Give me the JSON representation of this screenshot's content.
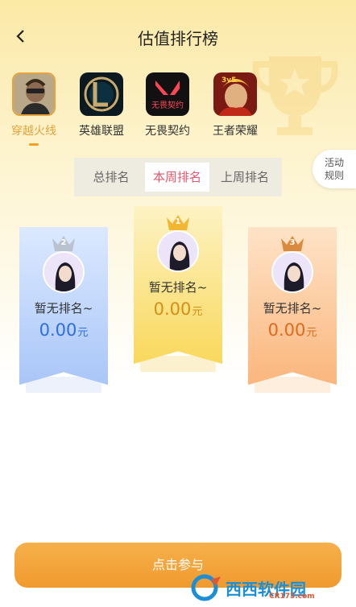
{
  "header": {
    "title": "估值排行榜"
  },
  "games": [
    {
      "label": "穿越火线",
      "active": true
    },
    {
      "label": "英雄联盟",
      "active": false
    },
    {
      "label": "无畏契约",
      "active": false
    },
    {
      "label": "王者荣耀",
      "active": false
    }
  ],
  "game_icon_text": {
    "valorant_cn": "无畏契约",
    "hok_badge": "3v5"
  },
  "rules": {
    "line1": "活动",
    "line2": "规则"
  },
  "tabs": [
    {
      "label": "总排名",
      "active": false
    },
    {
      "label": "本周排名",
      "active": true
    },
    {
      "label": "上周排名",
      "active": false
    }
  ],
  "podium": [
    {
      "rank": "2",
      "name": "暂无排名~",
      "amount": "0.00",
      "unit": "元"
    },
    {
      "rank": "1",
      "name": "暂无排名~",
      "amount": "0.00",
      "unit": "元"
    },
    {
      "rank": "3",
      "name": "暂无排名~",
      "amount": "0.00",
      "unit": "元"
    }
  ],
  "cta": {
    "label": "点击参与"
  },
  "watermark": {
    "text": "西西软件园",
    "sub": "CR173.com"
  },
  "colors": {
    "accent": "#e6a23c",
    "tab_active": "#e5556b",
    "cta": "#f3a43c"
  }
}
